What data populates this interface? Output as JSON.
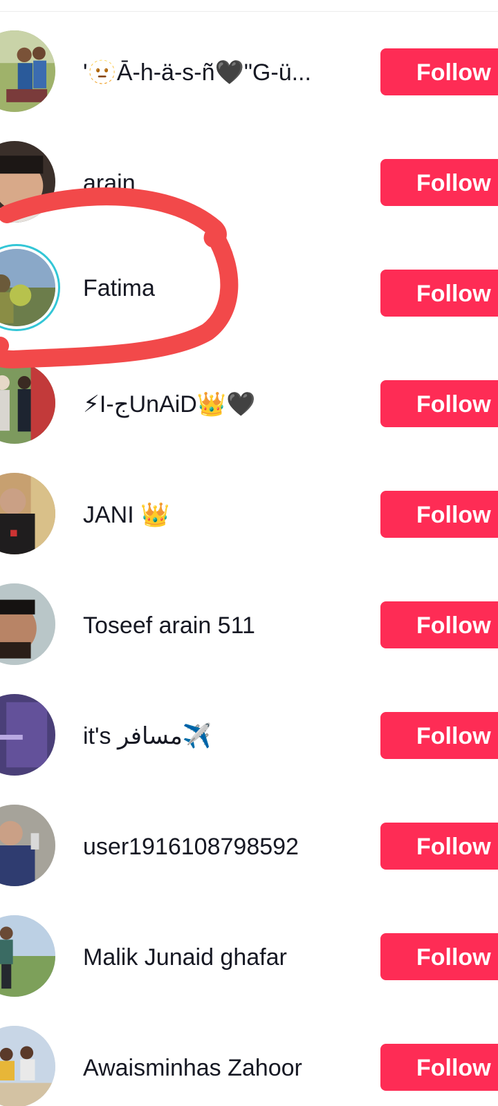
{
  "follow_label": "Follow",
  "users": [
    {
      "name": "'🫥Ā-h-ä-s-ñ🖤\"G-ü..."
    },
    {
      "name": "arain"
    },
    {
      "name": "Fatima"
    },
    {
      "name": "⚡I-جUnAiD👑🖤"
    },
    {
      "name": "JANI 👑"
    },
    {
      "name": "Toseef arain 511"
    },
    {
      "name": "it's مسافر✈️"
    },
    {
      "name": "user1916108798592"
    },
    {
      "name": "Malik Junaid ghafar"
    },
    {
      "name": "Awaisminhas Zahoor"
    }
  ],
  "colors": {
    "follow_button": "#fe2c55",
    "story_ring": "#33c6d6",
    "annotation": "#f2494a"
  },
  "annotation": "red hand-drawn circle around Fatima"
}
